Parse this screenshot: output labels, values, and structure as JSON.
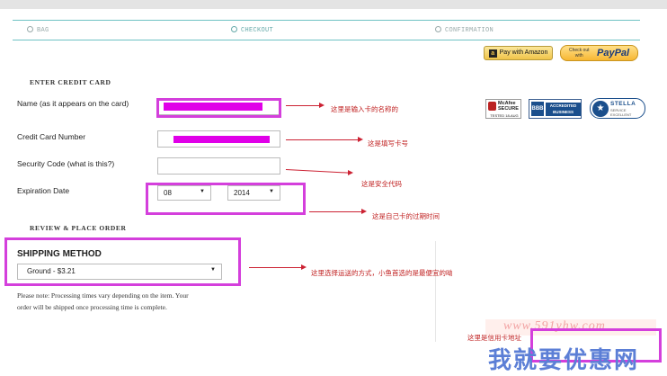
{
  "steps": [
    {
      "label": "BAG"
    },
    {
      "label": "CHECKOUT"
    },
    {
      "label": "CONFIRMATION"
    }
  ],
  "payments": {
    "amazon_label": "Pay with Amazon",
    "paypal_top": "Check out",
    "paypal_with": "with",
    "paypal_brand": "PayPal"
  },
  "credit_card": {
    "heading": "ENTER CREDIT CARD",
    "name_label": "Name (as it appears on the card)",
    "number_label": "Credit Card Number",
    "security_label": "Security Code (what is this?)",
    "expiration_label": "Expiration Date",
    "exp_month": "08",
    "exp_year": "2014"
  },
  "badges": {
    "mcafee_line1": "McAfee",
    "mcafee_line2": "SECURE",
    "mcafee_line3": "TESTED 18-AUG",
    "bbb_line1": "ACCREDITED",
    "bbb_line2": "BUSINESS",
    "stella_line1": "STELLA",
    "stella_line2": "SERVICE",
    "stella_line3": "EXCELLENT"
  },
  "review": {
    "heading": "REVIEW & PLACE ORDER",
    "shipping_title": "SHIPPING METHOD",
    "shipping_selected": "Ground - $3.21",
    "note_line1": "Please note: Processing times vary depending on the item. Your",
    "note_line2": "order will be shipped once processing time is complete."
  },
  "annotations": {
    "name_note": "这里是输入卡的名称的",
    "number_note": "这是填写卡号",
    "security_note": "这是安全代码",
    "expiration_note": "这是自己卡的过期时间",
    "shipping_note": "这里选择运送的方式，小鱼首选的是最便宜的呦",
    "bottom_note": "这里是信用卡地址"
  },
  "watermark": {
    "url": "www.591yhw.com",
    "site": "我就要优惠网"
  },
  "colors": {
    "accent_teal": "#6fc3c4",
    "highlight_magenta": "#e000e8",
    "annotation_red": "#c02020"
  }
}
